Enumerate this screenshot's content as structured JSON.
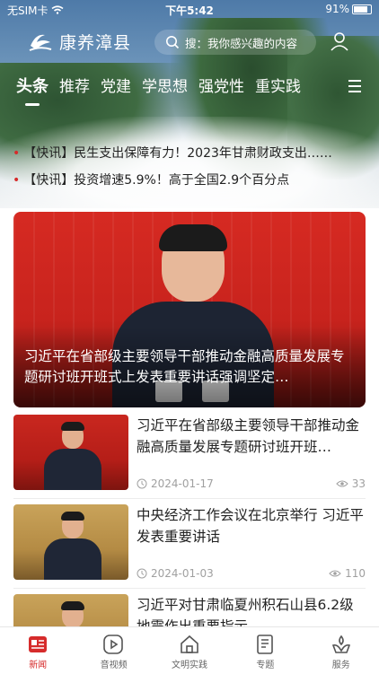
{
  "status_bar": {
    "carrier": "无SIM卡",
    "time": "下午5:42",
    "battery": "91%"
  },
  "header": {
    "app_name": "康养漳县",
    "search_placeholder": "搜：我你感兴趣的内容"
  },
  "channels": [
    "头条",
    "推荐",
    "党建",
    "学思想",
    "强党性",
    "重实践"
  ],
  "tickers": [
    "【快讯】民生支出保障有力！2023年甘肃财政支出……",
    "【快讯】投资增速5.9%！高于全国2.9个百分点"
  ],
  "featured": {
    "title": "习近平在省部级主要领导干部推动金融高质量发展专题研讨班开班式上发表重要讲话强调坚定…"
  },
  "news": [
    {
      "title": "习近平在省部级主要领导干部推动金融高质量发展专题研讨班开班…",
      "date": "2024-01-17",
      "views": "33"
    },
    {
      "title": "中央经济工作会议在北京举行 习近平发表重要讲话",
      "date": "2024-01-03",
      "views": "110"
    },
    {
      "title": "习近平对甘肃临夏州积石山县6.2级地震作出重要指示",
      "date": "",
      "views": ""
    }
  ],
  "tabbar": [
    {
      "label": "新闻",
      "icon": "news-icon",
      "active": true
    },
    {
      "label": "音视频",
      "icon": "video-icon",
      "active": false
    },
    {
      "label": "文明实践",
      "icon": "home-icon",
      "active": false
    },
    {
      "label": "专题",
      "icon": "topic-icon",
      "active": false
    },
    {
      "label": "服务",
      "icon": "service-icon",
      "active": false
    }
  ],
  "colors": {
    "accent": "#d62b2b",
    "tab_inactive": "#666666",
    "meta": "#a0a0a0"
  }
}
